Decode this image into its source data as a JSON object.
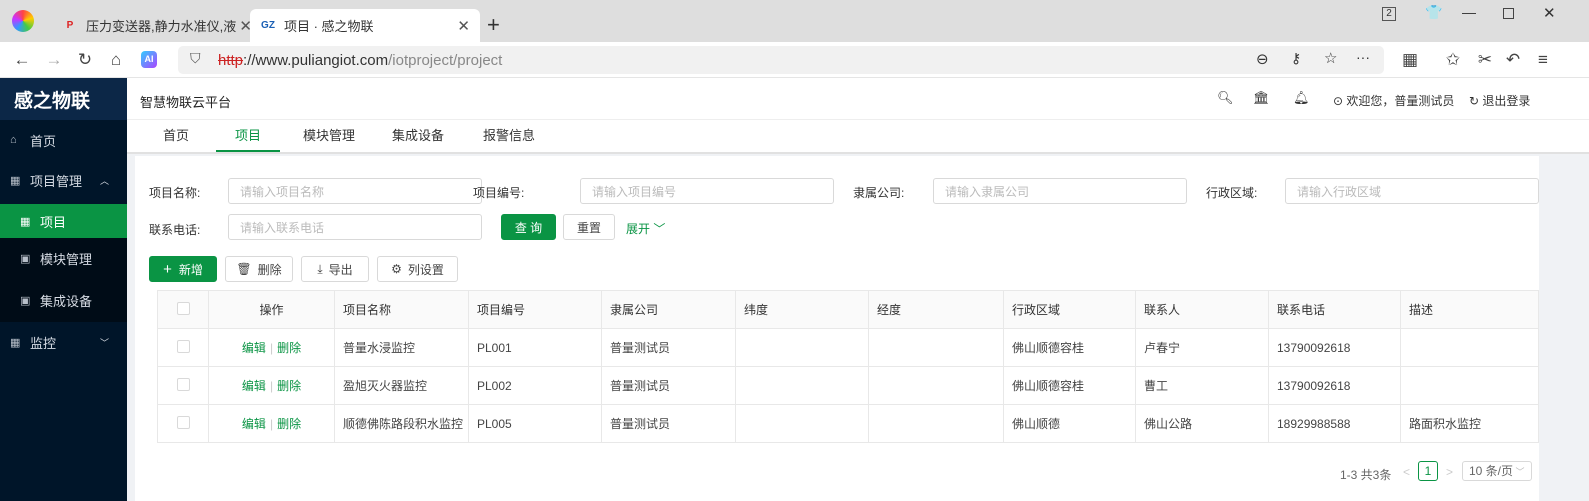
{
  "browser": {
    "tabs": [
      {
        "title": "压力变送器,静力水准仪,液位传",
        "favicon": "P"
      },
      {
        "title": "项目 · 感之物联",
        "favicon": "GZ"
      }
    ],
    "new_tab": "+",
    "url_scheme": "http",
    "url_host": "://www.puliangiot.com",
    "url_path": "/iotproject/project",
    "tab_count": "2",
    "ai_label": "AI"
  },
  "sidebar": {
    "logo": "感之物联",
    "items": [
      {
        "label": "首页"
      },
      {
        "label": "项目管理"
      },
      {
        "label": "项目"
      },
      {
        "label": "模块管理"
      },
      {
        "label": "集成设备"
      },
      {
        "label": "监控"
      }
    ]
  },
  "header": {
    "title": "智慧物联云平台",
    "welcome": "欢迎您，普量测试员",
    "logout": "退出登录"
  },
  "nav_tabs": [
    {
      "label": "首页"
    },
    {
      "label": "项目"
    },
    {
      "label": "模块管理"
    },
    {
      "label": "集成设备"
    },
    {
      "label": "报警信息"
    }
  ],
  "filters": {
    "name": {
      "label": "项目名称:",
      "placeholder": "请输入项目名称"
    },
    "code": {
      "label": "项目编号:",
      "placeholder": "请输入项目编号"
    },
    "company": {
      "label": "隶属公司:",
      "placeholder": "请输入隶属公司"
    },
    "region": {
      "label": "行政区域:",
      "placeholder": "请输入行政区域"
    },
    "phone": {
      "label": "联系电话:",
      "placeholder": "请输入联系电话"
    },
    "query": "查 询",
    "reset": "重置",
    "expand": "展开"
  },
  "actions": {
    "add": "新增",
    "delete": "删除",
    "export": "导出",
    "columns": "列设置"
  },
  "table": {
    "headers": [
      "操作",
      "项目名称",
      "项目编号",
      "隶属公司",
      "纬度",
      "经度",
      "行政区域",
      "联系人",
      "联系电话",
      "描述"
    ],
    "edit": "编辑",
    "del": "删除",
    "rows": [
      {
        "name": "普量水浸监控",
        "code": "PL001",
        "company": "普量测试员",
        "lat": "",
        "lng": "",
        "region": "佛山顺德容桂",
        "contact": "卢春宁",
        "phone": "13790092618",
        "desc": ""
      },
      {
        "name": "盈旭灭火器监控",
        "code": "PL002",
        "company": "普量测试员",
        "lat": "",
        "lng": "",
        "region": "佛山顺德容桂",
        "contact": "曹工",
        "phone": "13790092618",
        "desc": ""
      },
      {
        "name": "顺德佛陈路段积水监控",
        "code": "PL005",
        "company": "普量测试员",
        "lat": "",
        "lng": "",
        "region": "佛山顺德",
        "contact": "佛山公路",
        "phone": "18929988588",
        "desc": "路面积水监控"
      }
    ]
  },
  "pagination": {
    "total": "1-3 共3条",
    "current": "1",
    "page_size": "10 条/页"
  },
  "colors": {
    "accent": "#0a9444",
    "sidebar": "#001529"
  }
}
